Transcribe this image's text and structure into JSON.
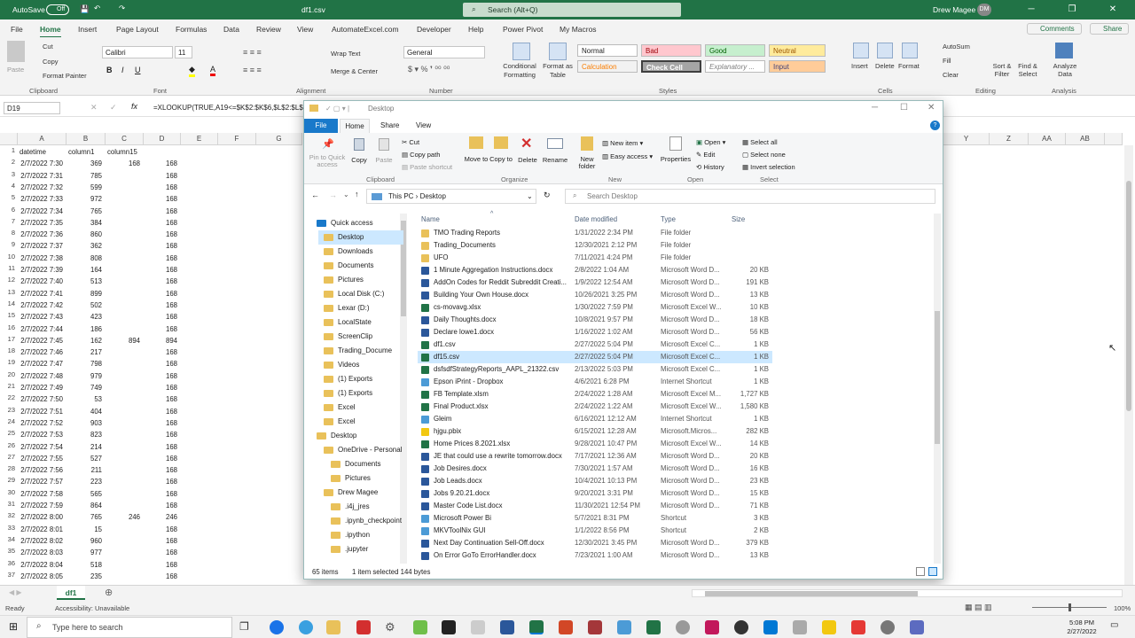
{
  "title_bar": {
    "autosave_label": "AutoSave",
    "autosave_state": "Off",
    "file_name": "df1.csv",
    "search_placeholder": "Search (Alt+Q)",
    "user_name": "Drew Magee",
    "user_initials": "DM"
  },
  "menu": {
    "tabs": [
      "File",
      "Home",
      "Insert",
      "Page Layout",
      "Formulas",
      "Data",
      "Review",
      "View",
      "AutomateExcel.com",
      "Developer",
      "Help",
      "Power Pivot",
      "My Macros"
    ],
    "comments": "Comments",
    "share": "Share"
  },
  "ribbon": {
    "clipboard": {
      "paste": "Paste",
      "cut": "Cut",
      "copy": "Copy",
      "format_painter": "Format Painter",
      "label": "Clipboard"
    },
    "font": {
      "name": "Calibri",
      "size": "11",
      "label": "Font"
    },
    "alignment": {
      "wrap": "Wrap Text",
      "merge": "Merge & Center",
      "label": "Alignment"
    },
    "number": {
      "format": "General",
      "label": "Number"
    },
    "styles": {
      "conditional": "Conditional Formatting",
      "format_as_table": "Format as Table",
      "normal": "Normal",
      "bad": "Bad",
      "good": "Good",
      "neutral": "Neutral",
      "calculation": "Calculation",
      "check_cell": "Check Cell",
      "explanatory": "Explanatory ...",
      "input": "Input",
      "label": "Styles"
    },
    "cells": {
      "insert": "Insert",
      "delete": "Delete",
      "format": "Format",
      "label": "Cells"
    },
    "editing": {
      "autosum": "AutoSum",
      "fill": "Fill",
      "clear": "Clear",
      "sort": "Sort & Filter",
      "find": "Find & Select",
      "label": "Editing"
    },
    "analysis": {
      "analyze": "Analyze Data",
      "label": "Analysis"
    }
  },
  "formula_bar": {
    "name_box": "D19",
    "formula": "=XLOOKUP(TRUE,A19<=$K$2:$K$6,$L$2:$L$"
  },
  "grid": {
    "columns": [
      "A",
      "B",
      "C",
      "D",
      "E",
      "F",
      "G"
    ],
    "right_columns": [
      "Y",
      "Z",
      "AA",
      "AB"
    ],
    "header": {
      "row": "1",
      "a": "datetime",
      "b": "column1",
      "c": "column15",
      "d": ""
    },
    "rows": [
      {
        "n": "2",
        "a": "2/7/2022 7:30",
        "b": "369",
        "c": "168",
        "d": "168"
      },
      {
        "n": "3",
        "a": "2/7/2022 7:31",
        "b": "785",
        "c": "",
        "d": "168"
      },
      {
        "n": "4",
        "a": "2/7/2022 7:32",
        "b": "599",
        "c": "",
        "d": "168"
      },
      {
        "n": "5",
        "a": "2/7/2022 7:33",
        "b": "972",
        "c": "",
        "d": "168"
      },
      {
        "n": "6",
        "a": "2/7/2022 7:34",
        "b": "765",
        "c": "",
        "d": "168"
      },
      {
        "n": "7",
        "a": "2/7/2022 7:35",
        "b": "384",
        "c": "",
        "d": "168"
      },
      {
        "n": "8",
        "a": "2/7/2022 7:36",
        "b": "860",
        "c": "",
        "d": "168"
      },
      {
        "n": "9",
        "a": "2/7/2022 7:37",
        "b": "362",
        "c": "",
        "d": "168"
      },
      {
        "n": "10",
        "a": "2/7/2022 7:38",
        "b": "808",
        "c": "",
        "d": "168"
      },
      {
        "n": "11",
        "a": "2/7/2022 7:39",
        "b": "164",
        "c": "",
        "d": "168"
      },
      {
        "n": "12",
        "a": "2/7/2022 7:40",
        "b": "513",
        "c": "",
        "d": "168"
      },
      {
        "n": "13",
        "a": "2/7/2022 7:41",
        "b": "899",
        "c": "",
        "d": "168"
      },
      {
        "n": "14",
        "a": "2/7/2022 7:42",
        "b": "502",
        "c": "",
        "d": "168"
      },
      {
        "n": "15",
        "a": "2/7/2022 7:43",
        "b": "423",
        "c": "",
        "d": "168"
      },
      {
        "n": "16",
        "a": "2/7/2022 7:44",
        "b": "186",
        "c": "",
        "d": "168"
      },
      {
        "n": "17",
        "a": "2/7/2022 7:45",
        "b": "162",
        "c": "894",
        "d": "894"
      },
      {
        "n": "18",
        "a": "2/7/2022 7:46",
        "b": "217",
        "c": "",
        "d": "168"
      },
      {
        "n": "19",
        "a": "2/7/2022 7:47",
        "b": "798",
        "c": "",
        "d": "168"
      },
      {
        "n": "20",
        "a": "2/7/2022 7:48",
        "b": "979",
        "c": "",
        "d": "168"
      },
      {
        "n": "21",
        "a": "2/7/2022 7:49",
        "b": "749",
        "c": "",
        "d": "168"
      },
      {
        "n": "22",
        "a": "2/7/2022 7:50",
        "b": "53",
        "c": "",
        "d": "168"
      },
      {
        "n": "23",
        "a": "2/7/2022 7:51",
        "b": "404",
        "c": "",
        "d": "168"
      },
      {
        "n": "24",
        "a": "2/7/2022 7:52",
        "b": "903",
        "c": "",
        "d": "168"
      },
      {
        "n": "25",
        "a": "2/7/2022 7:53",
        "b": "823",
        "c": "",
        "d": "168"
      },
      {
        "n": "26",
        "a": "2/7/2022 7:54",
        "b": "214",
        "c": "",
        "d": "168"
      },
      {
        "n": "27",
        "a": "2/7/2022 7:55",
        "b": "527",
        "c": "",
        "d": "168"
      },
      {
        "n": "28",
        "a": "2/7/2022 7:56",
        "b": "211",
        "c": "",
        "d": "168"
      },
      {
        "n": "29",
        "a": "2/7/2022 7:57",
        "b": "223",
        "c": "",
        "d": "168"
      },
      {
        "n": "30",
        "a": "2/7/2022 7:58",
        "b": "565",
        "c": "",
        "d": "168"
      },
      {
        "n": "31",
        "a": "2/7/2022 7:59",
        "b": "864",
        "c": "",
        "d": "168"
      },
      {
        "n": "32",
        "a": "2/7/2022 8:00",
        "b": "765",
        "c": "246",
        "d": "246"
      },
      {
        "n": "33",
        "a": "2/7/2022 8:01",
        "b": "15",
        "c": "",
        "d": "168"
      },
      {
        "n": "34",
        "a": "2/7/2022 8:02",
        "b": "960",
        "c": "",
        "d": "168"
      },
      {
        "n": "35",
        "a": "2/7/2022 8:03",
        "b": "977",
        "c": "",
        "d": "168"
      },
      {
        "n": "36",
        "a": "2/7/2022 8:04",
        "b": "518",
        "c": "",
        "d": "168"
      },
      {
        "n": "37",
        "a": "2/7/2022 8:05",
        "b": "235",
        "c": "",
        "d": "168"
      }
    ]
  },
  "explorer": {
    "title": "Desktop",
    "tabs": [
      "File",
      "Home",
      "Share",
      "View"
    ],
    "ribbon": {
      "pin": "Pin to Quick access",
      "copy": "Copy",
      "paste": "Paste",
      "cut": "Cut",
      "copy_path": "Copy path",
      "paste_shortcut": "Paste shortcut",
      "move_to": "Move to",
      "copy_to": "Copy to",
      "delete": "Delete",
      "rename": "Rename",
      "new_folder": "New folder",
      "new_item": "New item",
      "easy_access": "Easy access",
      "properties": "Properties",
      "open": "Open",
      "edit": "Edit",
      "history": "History",
      "select_all": "Select all",
      "select_none": "Select none",
      "invert": "Invert selection",
      "g_clipboard": "Clipboard",
      "g_organize": "Organize",
      "g_new": "New",
      "g_open": "Open",
      "g_select": "Select"
    },
    "address": {
      "this_pc": "This PC",
      "desktop": "Desktop",
      "search_placeholder": "Search Desktop"
    },
    "nav": [
      {
        "label": "Quick access",
        "level": 0
      },
      {
        "label": "Desktop",
        "level": 1,
        "sel": true
      },
      {
        "label": "Downloads",
        "level": 1
      },
      {
        "label": "Documents",
        "level": 1
      },
      {
        "label": "Pictures",
        "level": 1
      },
      {
        "label": "Local Disk (C:)",
        "level": 1
      },
      {
        "label": "Lexar (D:)",
        "level": 1
      },
      {
        "label": "LocalState",
        "level": 1
      },
      {
        "label": "ScreenClip",
        "level": 1
      },
      {
        "label": "Trading_Docume",
        "level": 1
      },
      {
        "label": "Videos",
        "level": 1
      },
      {
        "label": "(1) Exports",
        "level": 1
      },
      {
        "label": "(1) Exports",
        "level": 1
      },
      {
        "label": "Excel",
        "level": 1
      },
      {
        "label": "Excel",
        "level": 1
      },
      {
        "label": "Desktop",
        "level": 0
      },
      {
        "label": "OneDrive - Personal",
        "level": 1
      },
      {
        "label": "Documents",
        "level": 2
      },
      {
        "label": "Pictures",
        "level": 2
      },
      {
        "label": "Drew Magee",
        "level": 1
      },
      {
        "label": ".i4j_jres",
        "level": 2
      },
      {
        "label": ".ipynb_checkpoint",
        "level": 2
      },
      {
        "label": ".ipython",
        "level": 2
      },
      {
        "label": ".jupyter",
        "level": 2
      }
    ],
    "columns": {
      "name": "Name",
      "date": "Date modified",
      "type": "Type",
      "size": "Size"
    },
    "files": [
      {
        "name": "TMO Trading Reports",
        "date": "1/31/2022 2:34 PM",
        "type": "File folder",
        "size": "",
        "kind": "folder"
      },
      {
        "name": "Trading_Documents",
        "date": "12/30/2021 2:12 PM",
        "type": "File folder",
        "size": "",
        "kind": "folder"
      },
      {
        "name": "UFO",
        "date": "7/11/2021 4:24 PM",
        "type": "File folder",
        "size": "",
        "kind": "folder"
      },
      {
        "name": "1 Minute Aggregation Instructions.docx",
        "date": "2/8/2022 1:04 AM",
        "type": "Microsoft Word D...",
        "size": "20 KB",
        "kind": "word"
      },
      {
        "name": "AddOn Codes for Reddit Subreddit Creati...",
        "date": "1/9/2022 12:54 AM",
        "type": "Microsoft Word D...",
        "size": "191 KB",
        "kind": "word"
      },
      {
        "name": "Building Your Own House.docx",
        "date": "10/26/2021 3:25 PM",
        "type": "Microsoft Word D...",
        "size": "13 KB",
        "kind": "word"
      },
      {
        "name": "cs-movavg.xlsx",
        "date": "1/30/2022 7:59 PM",
        "type": "Microsoft Excel W...",
        "size": "10 KB",
        "kind": "excel"
      },
      {
        "name": "Daily Thoughts.docx",
        "date": "10/8/2021 9:57 PM",
        "type": "Microsoft Word D...",
        "size": "18 KB",
        "kind": "word"
      },
      {
        "name": "Declare lowe1.docx",
        "date": "1/16/2022 1:02 AM",
        "type": "Microsoft Word D...",
        "size": "56 KB",
        "kind": "word"
      },
      {
        "name": "df1.csv",
        "date": "2/27/2022 5:04 PM",
        "type": "Microsoft Excel C...",
        "size": "1 KB",
        "kind": "excel"
      },
      {
        "name": "df15.csv",
        "date": "2/27/2022 5:04 PM",
        "type": "Microsoft Excel C...",
        "size": "1 KB",
        "kind": "excel",
        "sel": true
      },
      {
        "name": "dsfsdfStrategyReports_AAPL_21322.csv",
        "date": "2/13/2022 5:03 PM",
        "type": "Microsoft Excel C...",
        "size": "1 KB",
        "kind": "excel"
      },
      {
        "name": "Epson iPrint - Dropbox",
        "date": "4/6/2021 6:28 PM",
        "type": "Internet Shortcut",
        "size": "1 KB",
        "kind": "link"
      },
      {
        "name": "FB Template.xlsm",
        "date": "2/24/2022 1:28 AM",
        "type": "Microsoft Excel M...",
        "size": "1,727 KB",
        "kind": "excel"
      },
      {
        "name": "Final Product.xlsx",
        "date": "2/24/2022 1:22 AM",
        "type": "Microsoft Excel W...",
        "size": "1,580 KB",
        "kind": "excel"
      },
      {
        "name": "Gleim",
        "date": "6/16/2021 12:12 AM",
        "type": "Internet Shortcut",
        "size": "1 KB",
        "kind": "link"
      },
      {
        "name": "hjgu.pbix",
        "date": "6/15/2021 12:28 AM",
        "type": "Microsoft.Micros...",
        "size": "282 KB",
        "kind": "pbi"
      },
      {
        "name": "Home Prices 8.2021.xlsx",
        "date": "9/28/2021 10:47 PM",
        "type": "Microsoft Excel W...",
        "size": "14 KB",
        "kind": "excel"
      },
      {
        "name": "JE that could use a rewrite tomorrow.docx",
        "date": "7/17/2021 12:36 AM",
        "type": "Microsoft Word D...",
        "size": "20 KB",
        "kind": "word"
      },
      {
        "name": "Job Desires.docx",
        "date": "7/30/2021 1:57 AM",
        "type": "Microsoft Word D...",
        "size": "16 KB",
        "kind": "word"
      },
      {
        "name": "Job Leads.docx",
        "date": "10/4/2021 10:13 PM",
        "type": "Microsoft Word D...",
        "size": "23 KB",
        "kind": "word"
      },
      {
        "name": "Jobs 9.20.21.docx",
        "date": "9/20/2021 3:31 PM",
        "type": "Microsoft Word D...",
        "size": "15 KB",
        "kind": "word"
      },
      {
        "name": "Master Code List.docx",
        "date": "11/30/2021 12:54 PM",
        "type": "Microsoft Word D...",
        "size": "71 KB",
        "kind": "word"
      },
      {
        "name": "Microsoft Power Bi",
        "date": "5/7/2021 8:31 PM",
        "type": "Shortcut",
        "size": "3 KB",
        "kind": "link"
      },
      {
        "name": "MKVToolNix GUI",
        "date": "1/1/2022 8:56 PM",
        "type": "Shortcut",
        "size": "2 KB",
        "kind": "link"
      },
      {
        "name": "Next Day Continuation Sell-Off.docx",
        "date": "12/30/2021 3:45 PM",
        "type": "Microsoft Word D...",
        "size": "379 KB",
        "kind": "word"
      },
      {
        "name": "On Error GoTo ErrorHandler.docx",
        "date": "7/23/2021 1:00 AM",
        "type": "Microsoft Word D...",
        "size": "13 KB",
        "kind": "word"
      }
    ],
    "status": {
      "count": "65 items",
      "selection": "1 item selected  144 bytes"
    }
  },
  "sheet": {
    "tab": "df1"
  },
  "status_bar": {
    "ready": "Ready",
    "accessibility": "Accessibility: Unavailable",
    "zoom": "100%"
  },
  "taskbar": {
    "search_placeholder": "Type here to search",
    "time": "5:08 PM",
    "date": "2/27/2022"
  },
  "colors": {
    "excel_green": "#217346",
    "selection_blue": "#cce8ff",
    "folder": "#e9c15a",
    "word": "#2b579a",
    "excel": "#217346"
  }
}
